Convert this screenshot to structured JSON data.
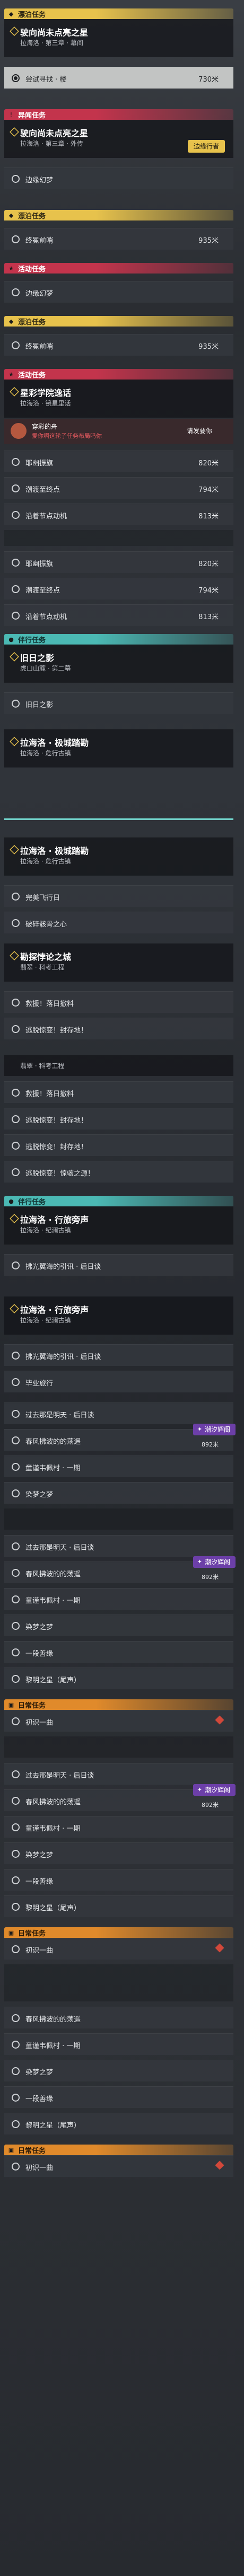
{
  "rows": [
    {
      "text": "尝试",
      "right": "730米",
      "distance": "730米",
      "sel": true
    },
    {
      "text": "边缘幻梦"
    },
    {
      "text": "终冕前哨",
      "distance": "935米"
    },
    {
      "text": "边缘幻梦"
    },
    {
      "text": "前哨",
      "distance": "935米"
    },
    {
      "text": "星彩学院逸话",
      "sub": "拉海洛 · 星彩学院"
    },
    {
      "text": "联络新回",
      "distance": "820米"
    },
    {
      "text": "潮渡至终点",
      "distance": "794米"
    },
    {
      "text": "沿着",
      "distance": "813米"
    },
    {
      "text": "联络新回",
      "distance": "820米"
    },
    {
      "text": "潮渡至终点",
      "distance": "794米"
    },
    {
      "text": "沿着节点动机",
      "distance": "813米"
    }
  ],
  "sections": {
    "s1": "漂泊任务",
    "s2": "异闻任务",
    "s3": "漂泊任务",
    "s4": "活动任务",
    "s5": "漂泊任务",
    "s6": "活动任务",
    "s7": "伴行任务",
    "s8": "伴行任务",
    "s9": "日常任务"
  },
  "quests": {
    "q1_title": "驶向尚未点亮之星",
    "q1_sub": "拉海洛 · 第三章 · 幕间",
    "q1_row_sel": "尝试寻找 · 楼",
    "q1_dist": "730米",
    "q2_title": "驶向尚未点亮之星",
    "q2_sub": "拉海洛 · 第三章 · 外传",
    "q2_badge": "边缘行者",
    "q2_row": "边缘幻梦",
    "q3_row": "终冕前哨",
    "q3_dist": "935米",
    "q4_row": "边缘幻梦",
    "q5_row": "终冕前哨",
    "q5_dist": "935米",
    "q6_title": "星彩学院逸话",
    "q6_sub": "拉海洛 · 镜星里话",
    "q6_cmt_name": "穿彩的舟",
    "q6_cmt_msg": "爱你啊这轮子任务布局吗你",
    "q6_cmt_right": "请发要你",
    "q6_r1": "耶幽振旗",
    "q6_r1_dist": "820米",
    "q6_r2": "潮渡至终点",
    "q6_r2_dist": "794米",
    "q6_r3": "沿着节点动机",
    "q6_r3_dist": "813米",
    "q7_r1": "耶幽振旗",
    "q7_r1_dist": "820米",
    "q7_r2": "潮渡至终点",
    "q7_r2_dist": "794米",
    "q7_r3": "沿着节点动机",
    "q7_r3_dist": "813米",
    "q8_title": "旧日之影",
    "q8_sub": "虎口山麓 · 第二幕",
    "q8_r1": "旧日之影",
    "q9_title": "拉海洛 · 极城踏勘",
    "q9_sub": "拉海洛 · 危行古镇",
    "q10_title": "拉海洛 · 极城踏勘",
    "q10_sub": "拉海洛 · 危行古镇",
    "q10_r1": "完美飞行日",
    "q10_r2": "破碎骸骨之心",
    "q11_title": "勘探悖论之城",
    "q11_sub": "翡翠 · 科考工程",
    "q11_r1": "救援！落日撤料",
    "q11_r2": "逃脱惊变！封存地！",
    "q12_sub": "翡翠 · 科考工程",
    "q12_r1": "救援！落日撤料",
    "q12_r2": "逃脱惊变！封存地！",
    "q12_r3": "逃脱惊变！封存地！",
    "q12_r4": "逃脱惊变！惊骇之源！",
    "q13_title": "拉海洛 · 行旅旁声",
    "q13_sub": "拉海洛 · 纪澜古镇",
    "q13_r1": "拂光翼海的引讯 · 后日谈",
    "q14_title": "拉海洛 · 行旅旁声",
    "q14_sub": "拉海洛 · 纪澜古镇",
    "q14_r1": "拂光翼海的引讯 · 后日谈",
    "q14_r2": "毕业旅行",
    "q14_r3": "过去那是明天 · 后日谈",
    "q14_r4": "春风拂波的的荡遥",
    "q14_dist4": "892米",
    "q14_badge": "潮汐辉阁",
    "q14_r5": "童谨韦佩村 · 一期",
    "q14_r6": "染梦之梦",
    "q15_r1": "过去那是明天 · 后日谈",
    "q15_r2": "春风拂波的的荡遥",
    "q15_dist2": "892米",
    "q15_badge": "潮汐辉阁",
    "q15_r3": "童谨韦佩村 · 一期",
    "q15_r4": "染梦之梦",
    "q15_r5": "一段善缘",
    "q15_r6": "黎明之星（尾声）",
    "q16_r1": "初识一曲",
    "q17_r1": "过去那是明天 · 后日谈",
    "q17_r2": "春风拂波的的荡遥",
    "q17_dist2": "892米",
    "q17_badge": "潮汐辉阁",
    "q17_r3": "童谨韦佩村 · 一期",
    "q17_r4": "染梦之梦",
    "q17_r5": "一段善缘",
    "q17_r6": "黎明之星（尾声）",
    "q18_r1": "初识一曲",
    "q19_r2": "春风拂波的的荡遥",
    "q19_r3": "童谨韦佩村 · 一期",
    "q19_r4": "染梦之梦",
    "q19_r5": "一段善缘",
    "q19_r6": "黎明之星（尾声）",
    "q20_r1": "初识一曲"
  },
  "colors": {
    "yellow": "#e7c24c",
    "red": "#c3344c",
    "teal": "#4bb9b4",
    "orange": "#e08a2b",
    "purple": "#6c3fa8"
  }
}
